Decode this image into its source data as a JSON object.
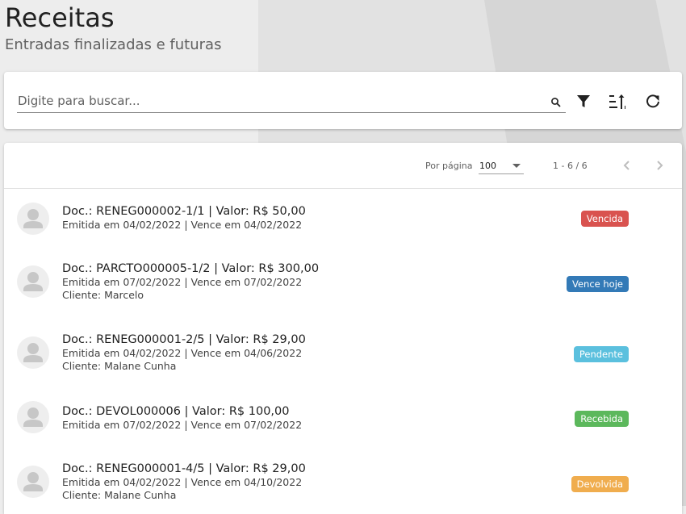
{
  "header": {
    "title": "Receitas",
    "subtitle": "Entradas finalizadas e futuras"
  },
  "search": {
    "placeholder": "Digite para buscar...",
    "value": "",
    "icons": [
      "search-icon",
      "filter-icon",
      "sort-icon",
      "refresh-icon"
    ]
  },
  "pager": {
    "per_page_label": "Por página",
    "per_page_value": "100",
    "range": "1 - 6 / 6"
  },
  "colors": {
    "vencida": "#d9534f",
    "vence_hoje": "#337ab7",
    "pendente": "#5bc0de",
    "recebida": "#5cb85c",
    "devolvida": "#f0ad4e"
  },
  "items": [
    {
      "line1": "Doc.: RENEG000002-1/1  | Valor: R$ 50,00",
      "line2": "Emitida em 04/02/2022 | Vence em 04/02/2022",
      "line3": "",
      "status": "Vencida",
      "status_color": "#d9534f"
    },
    {
      "line1": "Doc.: PARCTO000005-1/2  | Valor: R$ 300,00",
      "line2": "Emitida em 07/02/2022 | Vence em 07/02/2022",
      "line3": "Cliente: Marcelo",
      "status": "Vence hoje",
      "status_color": "#337ab7"
    },
    {
      "line1": "Doc.: RENEG000001-2/5  | Valor: R$ 29,00",
      "line2": "Emitida em 04/02/2022 | Vence em 04/06/2022",
      "line3": "Cliente: Malane Cunha",
      "status": "Pendente",
      "status_color": "#5bc0de"
    },
    {
      "line1": "Doc.: DEVOL000006  | Valor: R$ 100,00",
      "line2": "Emitida em 07/02/2022 | Vence em 07/02/2022",
      "line3": "",
      "status": "Recebida",
      "status_color": "#5cb85c"
    },
    {
      "line1": "Doc.: RENEG000001-4/5  | Valor: R$ 29,00",
      "line2": "Emitida em 04/02/2022 | Vence em 04/10/2022",
      "line3": "Cliente: Malane Cunha",
      "status": "Devolvida",
      "status_color": "#f0ad4e"
    }
  ]
}
